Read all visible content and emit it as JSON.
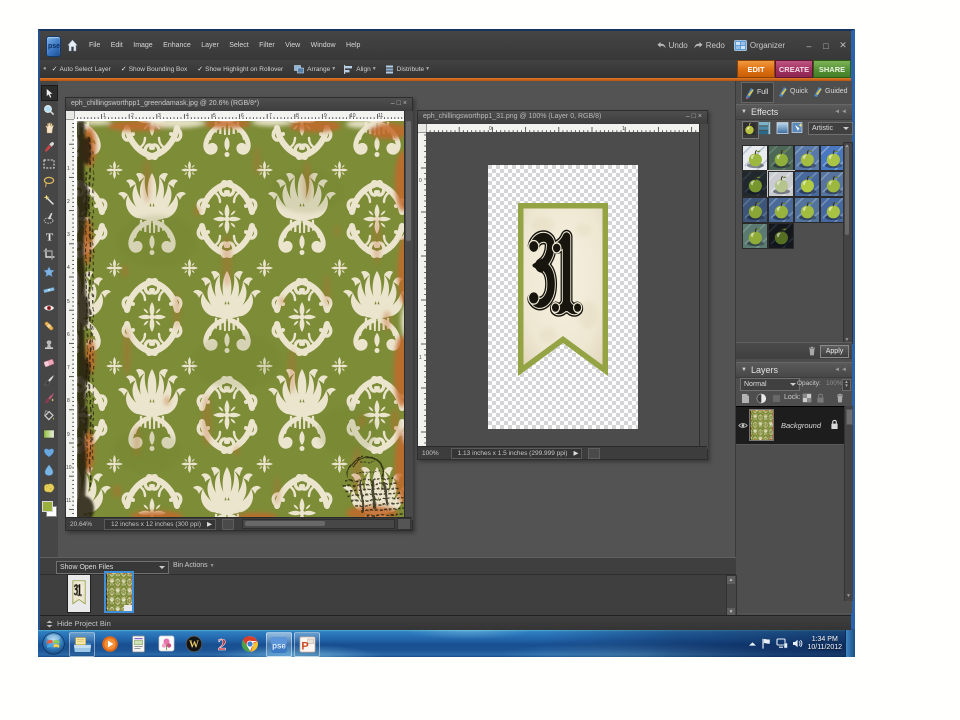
{
  "app": {
    "logo_text": "pse",
    "menu": [
      "File",
      "Edit",
      "Image",
      "Enhance",
      "Layer",
      "Select",
      "Filter",
      "View",
      "Window",
      "Help"
    ],
    "titlebar": {
      "undo": "Undo",
      "redo": "Redo",
      "organizer": "Organizer",
      "window_buttons": [
        "minimize",
        "maximize",
        "close"
      ]
    },
    "tabs": {
      "edit": "EDIT",
      "create": "CREATE",
      "share": "SHARE",
      "edit_color": "#e8821e",
      "create_color": "#a83a68",
      "share_color": "#569939"
    },
    "modes": {
      "full": "Full",
      "quick": "Quick",
      "guided": "Guided",
      "selected": "Full"
    },
    "options_bar": {
      "check1": "Auto Select Layer",
      "check2": "Show Bounding Box",
      "check3": "Show Highlight on Rollover",
      "btn_arrange": "Arrange",
      "btn_align": "Align",
      "btn_distribute": "Distribute"
    }
  },
  "documents": {
    "doc1": {
      "title": "eph_chillingsworthpp1_greendamask.jpg @ 20.6% (RGB/8*)",
      "zoom": "20.64%",
      "info": "12 inches x 12 inches (300 ppi)",
      "ruler_numbers": [
        "1",
        "2",
        "3",
        "4",
        "5",
        "6",
        "7",
        "8",
        "9",
        "10",
        "11"
      ]
    },
    "doc2": {
      "title": "eph_chillingsworthpp1_31.png @ 100% (Layer 0, RGB/8)",
      "zoom": "100%",
      "info": "1.13 inches x 1.5 inches (299.999 ppi)",
      "banner_number": "31",
      "ruler_numbers": [
        "0",
        "1"
      ]
    }
  },
  "effects_panel": {
    "title": "Effects",
    "category": "Artistic",
    "apply_label": "Apply",
    "thumbnails": [
      "artistic-01",
      "artistic-02",
      "artistic-03",
      "artistic-04",
      "artistic-05",
      "artistic-06",
      "artistic-07",
      "artistic-08",
      "artistic-09",
      "artistic-10",
      "artistic-11",
      "artistic-12",
      "artistic-13",
      "artistic-14"
    ]
  },
  "layers_panel": {
    "title": "Layers",
    "blend_mode": "Normal",
    "opacity_label": "Opacity:",
    "opacity_value": "100%",
    "lock_label": "Lock:",
    "layers": [
      {
        "name": "Background",
        "locked": true,
        "visible": true
      }
    ]
  },
  "project_bin": {
    "show_open_files": "Show Open Files",
    "bin_actions": "Bin Actions",
    "hide_label": "Hide Project Bin",
    "thumbnails": [
      "banner-31-thumbnail",
      "green-damask-thumbnail"
    ]
  },
  "taskbar": {
    "icons": [
      "start-orb",
      "windows-explorer",
      "media-player",
      "notepad",
      "photo-tool",
      "warcraft",
      "sims2",
      "chrome",
      "photoshop-elements",
      "powerpoint"
    ],
    "open_apps": [
      "windows-explorer",
      "photoshop-elements",
      "powerpoint"
    ],
    "clock_time": "1:34 PM",
    "clock_date": "10/11/2012"
  }
}
